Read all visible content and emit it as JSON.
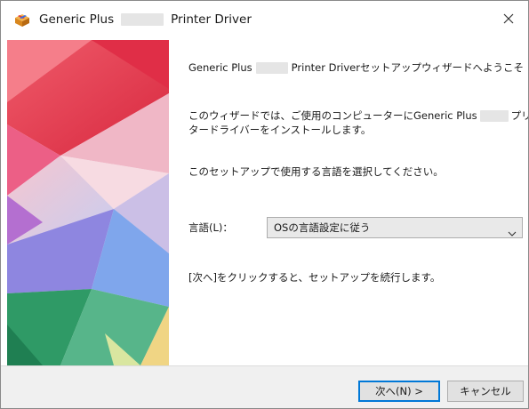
{
  "window": {
    "title_prefix": "Generic Plus",
    "title_suffix": "Printer Driver"
  },
  "content": {
    "welcome_prefix": "Generic Plus",
    "welcome_suffix": "Printer Driverセットアップウィザードへようこそ",
    "desc_line1_prefix": "このウィザードでは、ご使用のコンピューターにGeneric Plus",
    "desc_line1_suffix": "プリン",
    "desc_line2": "タードライバーをインストールします。",
    "choose_language": "このセットアップで使用する言語を選択してください。",
    "language_label": "言語(L)：",
    "language_selected": "OSの言語設定に従う",
    "next_hint": "[次へ]をクリックすると、セットアップを続行します。"
  },
  "buttons": {
    "next": "次へ(N) >",
    "cancel": "キャンセル"
  },
  "icons": {
    "title": "setup-box-icon",
    "close": "close-icon",
    "dropdown": "chevron-down-icon"
  },
  "colors": {
    "accent": "#0078d7",
    "footer_bg": "#f0f0f0",
    "banner_red": "#e8364a",
    "banner_magenta": "#e06aa6",
    "banner_blue": "#6aa0e8",
    "banner_green": "#3aa872",
    "banner_yellow": "#f0d070"
  }
}
